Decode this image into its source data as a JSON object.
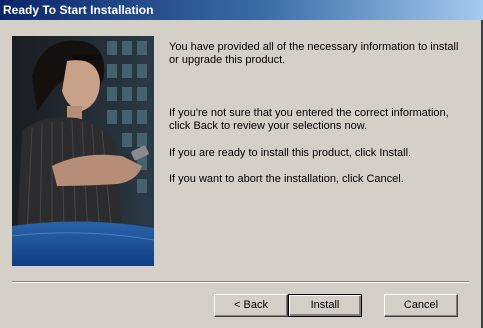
{
  "window": {
    "title": "Ready To Start Installation"
  },
  "main": {
    "paragraphs": [
      "You have provided all of the necessary information to install or upgrade this product.",
      "If you're not sure that you entered the correct information, click Back to review your selections now.",
      "If you are ready to install this product, click Install.",
      "If you want to abort the installation, click Cancel."
    ]
  },
  "buttons": {
    "back": "< Back",
    "install": "Install",
    "cancel": "Cancel"
  },
  "colors": {
    "title_gradient_start": "#0a246a",
    "title_gradient_end": "#a6caf0",
    "dialog_bg": "#d4d0c8"
  }
}
